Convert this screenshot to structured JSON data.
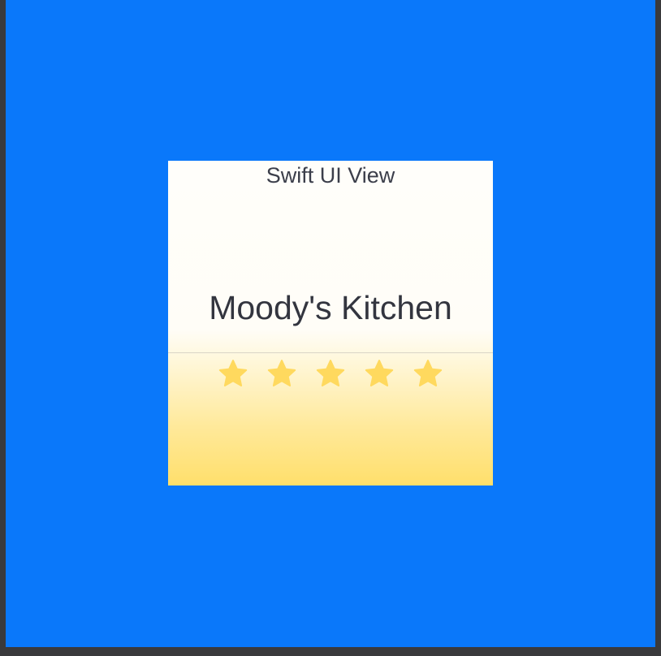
{
  "canvas": {
    "background_color": "#0A78FA"
  },
  "card": {
    "title": "Swift UI View",
    "restaurant_name": "Moody's Kitchen",
    "rating": {
      "value": 5,
      "max": 5,
      "star_color": "#FFD95E",
      "icon": "star-icon"
    },
    "gradient_colors": [
      "#FFFEFA",
      "#FFDF6B"
    ]
  }
}
